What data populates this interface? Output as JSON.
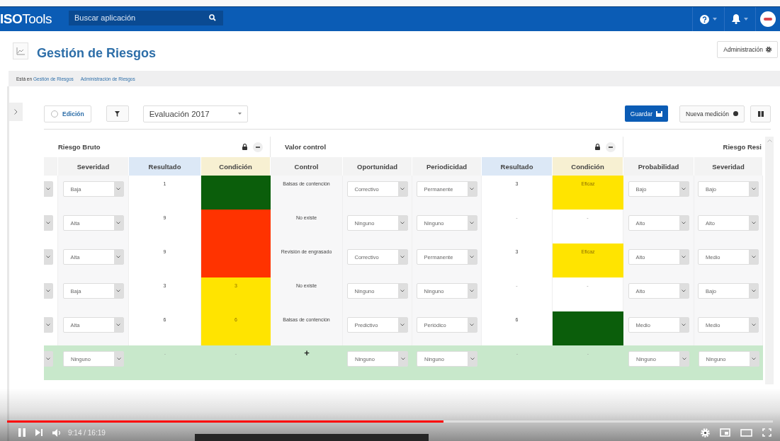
{
  "app": {
    "logo": "**ISO**Tools",
    "search": {
      "placeholder": "Buscar aplicación"
    }
  },
  "page": {
    "title": "Gestión de Riesgos",
    "admin_button": "Administración"
  },
  "breadcrumb": {
    "prefix": "Está en",
    "links": [
      "Gestión de Riesgos",
      "Administración de Riesgos"
    ]
  },
  "toolbar": {
    "edit_toggle": {
      "label": "Edición",
      "checked": false
    },
    "evaluation_select": "Evaluación 2017",
    "save_button": "Guardar",
    "new_measure_button": "Nueva medición"
  },
  "table": {
    "groups": [
      {
        "title": "Riesgo Bruto",
        "columns": [
          {
            "label": "Severidad",
            "kind": "select"
          },
          {
            "label": "Resultado",
            "kind": "result"
          },
          {
            "label": "Condición",
            "kind": "condition"
          }
        ]
      },
      {
        "title": "Valor control",
        "columns": [
          {
            "label": "Control",
            "kind": "text"
          },
          {
            "label": "Oportunidad",
            "kind": "select"
          },
          {
            "label": "Periodicidad",
            "kind": "select"
          },
          {
            "label": "Resultado",
            "kind": "result"
          },
          {
            "label": "Condición",
            "kind": "condition"
          }
        ]
      },
      {
        "title": "Riesgo Resi",
        "columns": [
          {
            "label": "Probabilidad",
            "kind": "select"
          },
          {
            "label": "Severidad",
            "kind": "select"
          }
        ]
      }
    ],
    "rows": [
      {
        "kind": "data",
        "cells": [
          "Baja",
          "1",
          {
            "color": "#0b5e0b"
          },
          "Balsas de contención",
          "Correctivo",
          "Permanente",
          "3",
          {
            "text": "Eficaz",
            "color": "#ffe400"
          },
          "Bajo",
          "Bajo"
        ]
      },
      {
        "kind": "data",
        "cells": [
          "Alta",
          "9",
          {
            "color": "#ff3300"
          },
          "No existe",
          "Ninguno",
          "Ninguno",
          "-",
          {
            "text": "-"
          },
          "Alto",
          "Alto"
        ]
      },
      {
        "kind": "data",
        "cells": [
          "Alta",
          "9",
          {
            "color": "#ff3300"
          },
          "Revisión de engrasado",
          "Correctivo",
          "Permanente",
          "3",
          {
            "text": "Eficaz",
            "color": "#ffe400"
          },
          "Alto",
          "Medio"
        ]
      },
      {
        "kind": "data",
        "cells": [
          "Baja",
          "3",
          {
            "text": "3",
            "color": "#ffe400"
          },
          "No existe",
          "Ninguno",
          "Ninguno",
          "-",
          {
            "text": "-"
          },
          "Alto",
          "Bajo"
        ]
      },
      {
        "kind": "data",
        "cells": [
          "Alta",
          "6",
          {
            "text": "6",
            "color": "#ffe400"
          },
          "Balsas de contención",
          "Predictivo",
          "Periódico",
          "6",
          {
            "color": "#0b5e0b"
          },
          "Medio",
          "Medio"
        ]
      },
      {
        "kind": "new",
        "cells": [
          "Ninguno",
          "-",
          {
            "text": "-"
          },
          "+",
          "Ninguno",
          "Ninguno",
          "-",
          {
            "text": "-"
          },
          "Ninguno",
          "Ninguno"
        ]
      }
    ]
  },
  "video_player": {
    "playing": true,
    "progress": {
      "level": 0.57
    },
    "time": "9:14 / 16:19"
  }
}
